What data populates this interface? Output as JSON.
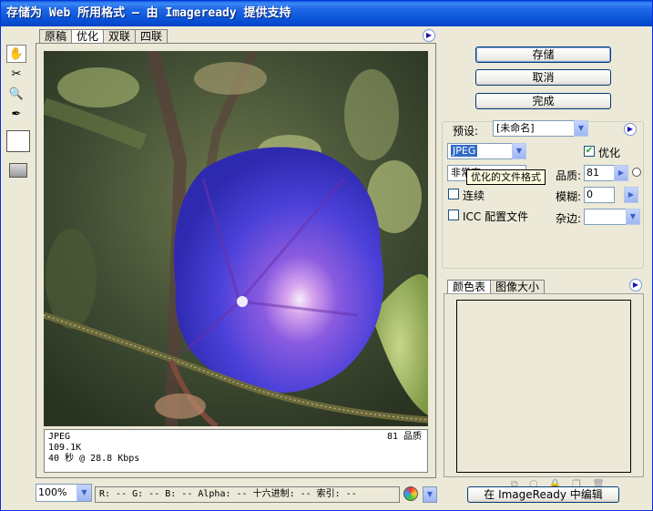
{
  "window": {
    "title": "存储为 Web 所用格式 — 由 Imageready 提供支持"
  },
  "view_tabs": [
    "原稿",
    "优化",
    "双联",
    "四联"
  ],
  "image_info": {
    "format": "JPEG",
    "size": "109.1K",
    "download_time": "40 秒 @ 28.8 Kbps",
    "quality_text": "81 品质"
  },
  "status": {
    "zoom": "100%",
    "color_readout": "R:  -- G:  -- B:  -- Alpha:  -- 十六进制:   -- 索引:  --"
  },
  "buttons": {
    "save": "存储",
    "cancel": "取消",
    "done": "完成",
    "edit_in_imageready": "在 ImageReady 中编辑"
  },
  "settings": {
    "preset_label": "预设:",
    "preset_value": "[未命名]",
    "format_value": "JPEG",
    "optimized_label": "优化",
    "optimized_checked": true,
    "quality_level_value": "非常高",
    "quality_label": "品质:",
    "quality_value": "81",
    "progressive_label": "连续",
    "progressive_checked": false,
    "blur_label": "模糊:",
    "blur_value": "0",
    "icc_label": "ICC 配置文件",
    "icc_checked": false,
    "matte_label": "杂边:",
    "tooltip": "优化的文件格式"
  },
  "color_panel": {
    "tabs": [
      "颜色表",
      "图像大小"
    ]
  },
  "icons": {
    "hand": "hand-icon",
    "slice_select": "slice-select-icon",
    "zoom": "zoom-icon",
    "eyedropper": "eyedropper-icon"
  },
  "colors": {
    "title_blue": "#0a54d8",
    "accent_blue": "#316ac5",
    "flower_purple": "#4b3fd6"
  }
}
